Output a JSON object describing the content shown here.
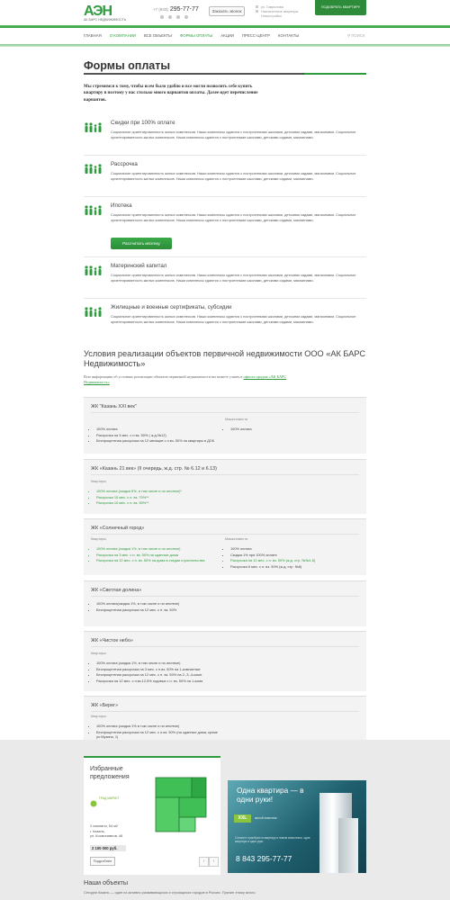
{
  "header": {
    "logo_mark": "АЭН",
    "logo_sub": "АК БАРС НЕДВИЖИМОСТЬ",
    "phone_code": "+7 (843)",
    "phone_number": "295-77-77",
    "call_button": "Заказать звонок",
    "address_lines": [
      "ул. Гаврилова",
      "Назначенные квартиры",
      "Новостройки"
    ],
    "pick_button": "ПОДОБРАТЬ КВАРТИРУ"
  },
  "nav": {
    "items": [
      "ГЛАВНАЯ",
      "О КОМПАНИИ",
      "ВСЕ ОБЪЕКТЫ",
      "ФОРМЫ ОПЛАТЫ",
      "АКЦИИ",
      "ПРЕСС-ЦЕНТР",
      "КОНТАКТЫ"
    ],
    "active_index": 3,
    "search_label": "ПОИСК"
  },
  "page": {
    "title": "Формы оплаты",
    "intro": "Мы стремимся к тому, чтобы всем было удобно и все могли позволить себе купить квартиру в поэтому у нас столько много вариантов оплаты. Далее идет перечисление вариантов.",
    "mortgage_button": "Рассчитать ипотеку",
    "accent_color": "#2e9b3e"
  },
  "payments": [
    {
      "title": "Скидки при 100% оплате",
      "text": "Социальное ориентированность жилых комплексов. Наши комплексы сдаются с построенными школами, детскими садами, магазинами. Социальное ориентированность жилых комплексов. Наши комплексы сдаются с построенными школами, детскими садами, магазинами."
    },
    {
      "title": "Рассрочка",
      "text": "Социальное ориентированность жилых комплексов. Наши комплексы сдаются с построенными школами, детскими садами, магазинами. Социальное ориентированность жилых комплексов. Наши комплексы сдаются с построенными школами, детскими садами, магазинами."
    },
    {
      "title": "Ипотека",
      "text": "Социальное ориентированность жилых комплексов. Наши комплексы сдаются с построенными школами, детскими садами, магазинами. Социальное ориентированность жилых комплексов. Наши комплексы сдаются с построенными школами, детскими садами, магазинами."
    },
    {
      "title": "Материнский капитал",
      "text": "Социальное ориентированность жилых комплексов. Наши комплексы сдаются с построенными школами, детскими садами, магазинами. Социальное ориентированность жилых комплексов. Наши комплексы сдаются с построенными школами, детскими садами, магазинами."
    },
    {
      "title": "Жилищные и военные сертификаты, субсидии",
      "text": "Социальное ориентированность жилых комплексов. Наши комплексы сдаются с построенными школами, детскими садами, магазинами. Социальное ориентированность жилых комплексов. Наши комплексы сдаются с построенными школами, детскими садами, магазинами."
    }
  ],
  "conditions": {
    "title": "Условия реализации объектов первичной недвижимости ООО «АК БАРС Недвижимость»",
    "note": "Всю информацию об условиях реализации объектов первичной недвижимости вы можете узнать в",
    "note_link": "офисах продаж «АК БАРС Недвижимость»",
    "flat_label": "Квартиры",
    "parking_label": "Машиноместа"
  },
  "complexes": [
    {
      "name": "ЖК \"Казань XXI век\"",
      "flats": [
        "100% оплата",
        "Рассрочка на 3 мес. с п.вз. 50% ( ж.д.№12)",
        "Беспроцентная рассрочка на 12 месяцев с п.вз. 50% на квартиры в ДОК"
      ],
      "parking": [
        "100% оплата"
      ]
    },
    {
      "name": "ЖК «Казань 21 век» (II очередь, ж.д. стр. № 6.12 и 6.13)",
      "flats": [
        "100% оплата (скидка 5%, в том числе и по ипотеке)*",
        "Рассрочка 10 мес. с п. вз. 70%**",
        "Рассрочка 10 мес. с п. вз. 50%**"
      ],
      "parking": []
    },
    {
      "name": "ЖК «Солнечный город»",
      "flats": [
        "100% оплата (скидка 1%, в том числе и по ипотеке)",
        "Рассрочка на 3 мес. с п. вз. 50% на сданные дома",
        "Рассрочка на 12 мес. с п. вз. 50% на дома в стадии строительства"
      ],
      "parking": [
        "100% оплата",
        "Скидка 1% при 100% оплате",
        "Рассрочка на 12 мес. с п. вз. 50% (ж.д. стр. №№1,8)",
        "Рассрочка 6 мес. с п. вз. 50% (ж.д. стр. №8)"
      ]
    },
    {
      "name": "ЖК «Светлая долина»",
      "flats": [
        "100% оплата(скидка 1%, в том числе и по ипотеке)",
        "Беспроцентная рассрочка на 12 мес. с п. вз. 50%"
      ],
      "parking": []
    },
    {
      "name": "ЖК «Чистое небо»",
      "flats": [
        "100% оплата (скидка 1%, в том числе и по ипотеке)",
        "Беспроцентная рассрочка на 3 мес. с п.вз. 50% на 1-комнатные",
        "Беспроцентная рассрочка на 12 мес. с п. вз. 50% на 2-,3-,4-комн.",
        "Рассрочка на 12 мес. с п.вз.12,5% годовых с п. вз. 50% на 1-комн."
      ],
      "parking": []
    },
    {
      "name": "ЖК «Берег»",
      "flats": [
        "100% оплата (скидка 1% в том числе и по ипотеке)",
        "Беспроцентная рассрочка на 12 мес. с п.вз. 50% (на сданные дома, кроме ул.Музина, 1)",
        "Беспроцентная рассрочка на 6 мес. с п.вз. 50% (ул.Музина, 1)",
        "Рассрочка на 12 мес. с п.вз. 50% под 12.5% (ул.Музина, 1)"
      ],
      "parking": []
    }
  ],
  "featured": {
    "title": "Избранные предложения",
    "brand": "ГРАД МАРКЕТ",
    "rooms": "2 комнаты, 54 м2",
    "city": "г. Казань,",
    "street": "ул. Космонавтов, 46",
    "price": "2 100 000 руб.",
    "more_button": "Подробнее",
    "prev": "‹",
    "next": "›"
  },
  "banner": {
    "headline": "Одна квартира — в одни руки!",
    "xxl": "XXL",
    "tag": "жилой комплекс",
    "small": "Спешите приобрести квартиру в новом комплексе, одна квартира в одни руки",
    "phone": "8 843 295-77-77"
  },
  "objects": {
    "title": "Наши объекты",
    "text": "Сегодня Казань — один из активно развивающихся и строящихся городов в России. Причин этому много."
  }
}
